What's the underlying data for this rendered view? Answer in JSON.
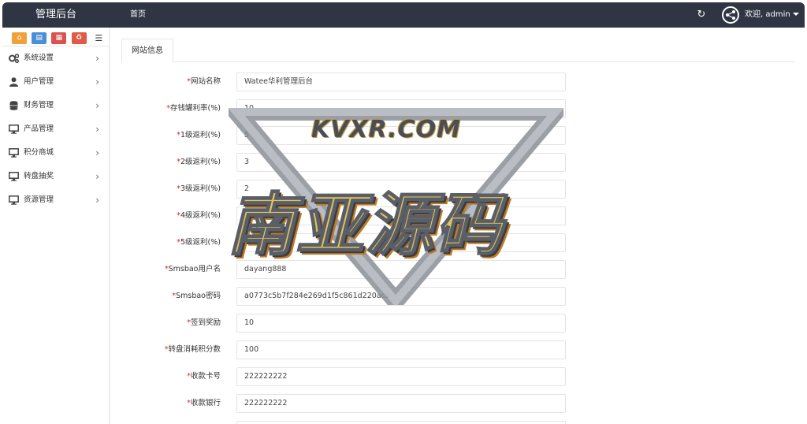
{
  "header": {
    "brand": "管理后台",
    "nav_home": "首页",
    "user_label": "欢迎, admin"
  },
  "sidebar": {
    "shortcut_icons": [
      "home-icon",
      "file-icon",
      "trash-icon",
      "recycle-icon",
      "list-icon"
    ],
    "items": [
      {
        "label": "系统设置",
        "icon": "gears-icon"
      },
      {
        "label": "用户管理",
        "icon": "user-icon"
      },
      {
        "label": "财务管理",
        "icon": "database-icon"
      },
      {
        "label": "产品管理",
        "icon": "desktop-icon"
      },
      {
        "label": "积分商城",
        "icon": "desktop-icon"
      },
      {
        "label": "转盘抽奖",
        "icon": "desktop-icon"
      },
      {
        "label": "资源管理",
        "icon": "desktop-icon"
      }
    ]
  },
  "main": {
    "tab": "网站信息",
    "fields": [
      {
        "label": "网站名称",
        "value": "Watee华利管理后台"
      },
      {
        "label": "存钱罐利率(%)",
        "value": "10"
      },
      {
        "label": "1级返利(%)",
        "value": "5"
      },
      {
        "label": "2级返利(%)",
        "value": "3"
      },
      {
        "label": "3级返利(%)",
        "value": "2"
      },
      {
        "label": "4级返利(%)",
        "value": "1"
      },
      {
        "label": "5级返利(%)",
        "value": "1"
      },
      {
        "label": "Smsbao用户名",
        "value": "dayang888"
      },
      {
        "label": "Smsbao密码",
        "value": "a0773c5b7f284e269d1f5c861d220acb"
      },
      {
        "label": "签到奖励",
        "value": "10"
      },
      {
        "label": "转盘消耗积分数",
        "value": "100"
      },
      {
        "label": "收款卡号",
        "value": "222222222"
      },
      {
        "label": "收款银行",
        "value": "222222222"
      }
    ],
    "required_mark": "*"
  },
  "watermark": {
    "site": "KVXR.COM",
    "text": "南亚源码"
  },
  "colors": {
    "topbar": "#2f3542",
    "required": "#e02020"
  }
}
